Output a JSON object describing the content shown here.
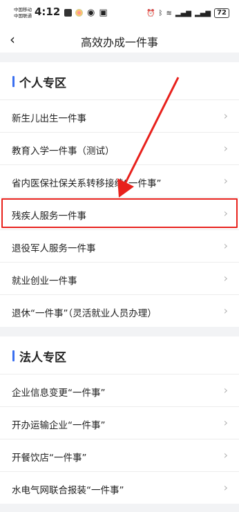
{
  "status_bar": {
    "carrier_1": "中国移动",
    "carrier_2": "中国联通",
    "time": "4:12",
    "battery": "72"
  },
  "nav": {
    "back_glyph": "‹",
    "title": "高效办成一件事"
  },
  "personal": {
    "title": "个人专区",
    "items": [
      {
        "label": "新生儿出生一件事"
      },
      {
        "label": "教育入学一件事（测试）"
      },
      {
        "label": "省内医保社保关系转移接续“一件事”"
      },
      {
        "label": "残疾人服务一件事"
      },
      {
        "label": "退役军人服务一件事"
      },
      {
        "label": "就业创业一件事"
      },
      {
        "label": "退休“一件事”（灵活就业人员办理）"
      }
    ]
  },
  "corporate": {
    "title": "法人专区",
    "items": [
      {
        "label": "企业信息变更“一件事”"
      },
      {
        "label": "开办运输企业“一件事”"
      },
      {
        "label": "开餐饮店“一件事”"
      },
      {
        "label": "水电气网联合报装“一件事”"
      }
    ]
  },
  "chevron_glyph": "›",
  "colors": {
    "accent": "#3a6ff0",
    "annotation_red": "#e8211c"
  }
}
